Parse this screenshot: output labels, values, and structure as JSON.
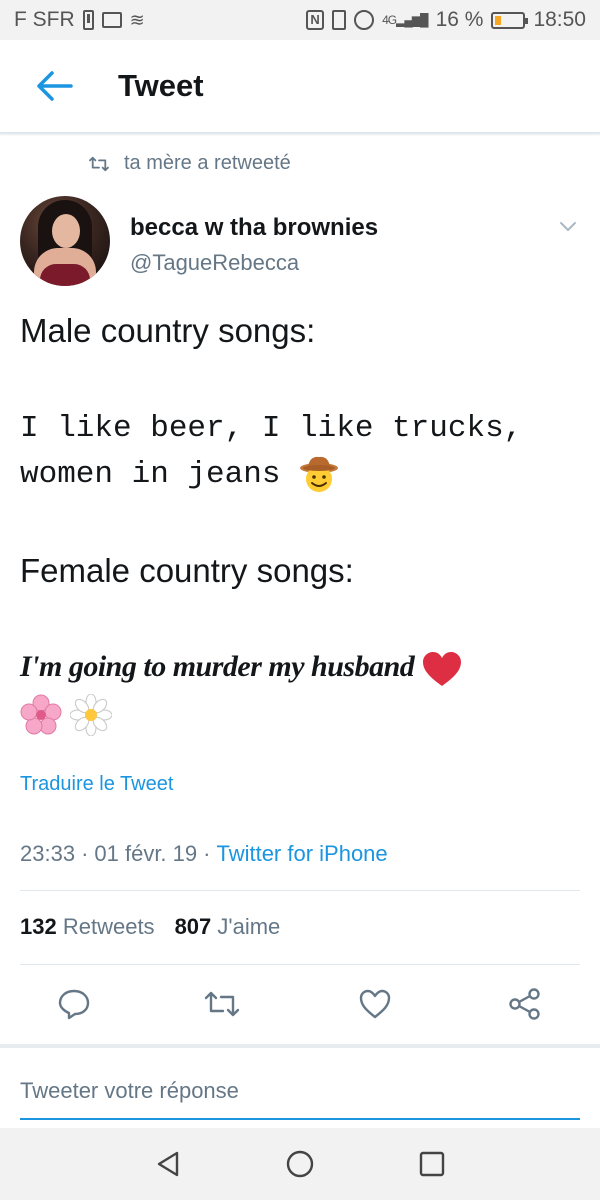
{
  "status_bar": {
    "carrier": "F SFR",
    "signal_label": "4G",
    "battery_percent": "16 %",
    "time": "18:50"
  },
  "header": {
    "title": "Tweet"
  },
  "retweet_context": {
    "text": "ta mère a retweeté"
  },
  "author": {
    "name": "becca w tha brownies",
    "handle": "@TagueRebecca"
  },
  "tweet": {
    "line1": "Male country songs:",
    "line2a": "I like beer, I like trucks,",
    "line2b": "women in jeans",
    "line3": "Female country songs:",
    "line4": "I'm going to murder my husband"
  },
  "translate_label": "Traduire le Tweet",
  "meta": {
    "time": "23:33",
    "separator": "·",
    "date": "01 févr. 19",
    "source": "Twitter for iPhone"
  },
  "stats": {
    "retweets_count": "132",
    "retweets_label": "Retweets",
    "likes_count": "807",
    "likes_label": "J'aime"
  },
  "reply": {
    "placeholder": "Tweeter votre réponse"
  },
  "colors": {
    "accent": "#1b95e0",
    "muted": "#657786",
    "text": "#14171a",
    "border": "#e1e8ed"
  },
  "icons": {
    "back": "arrow-left-icon",
    "retweet": "retweet-icon",
    "reply": "comment-icon",
    "like": "heart-icon",
    "share": "share-icon",
    "caret": "chevron-down-icon"
  }
}
